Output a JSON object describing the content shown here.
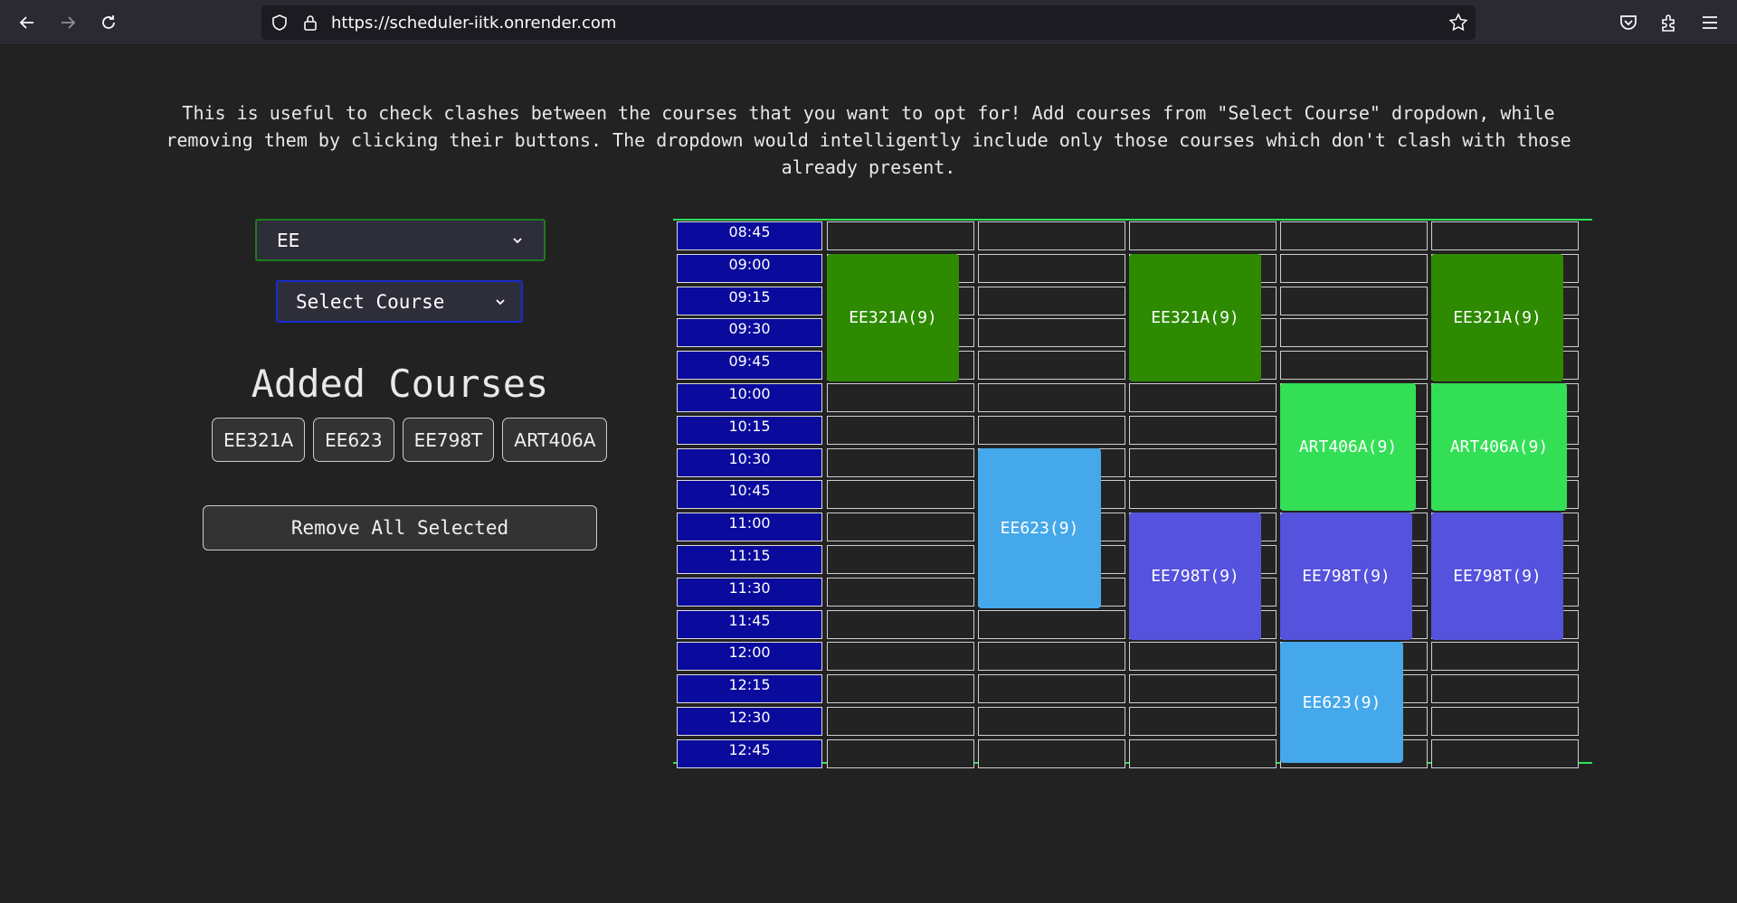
{
  "browser": {
    "url": "https://scheduler-iitk.onrender.com"
  },
  "intro_text": "This is useful to check clashes between the courses that you want to opt for! Add courses from \"Select Course\" dropdown, while removing them by clicking their buttons. The dropdown would intelligently include only those courses which don't clash with those already present.",
  "branch_select": {
    "value": "EE"
  },
  "course_select": {
    "value": "Select Course"
  },
  "added_courses": {
    "heading": "Added Courses",
    "items": [
      "EE321A",
      "EE623",
      "EE798T",
      "ART406A"
    ]
  },
  "remove_all_label": "Remove All Selected",
  "timetable": {
    "times": [
      "08:45",
      "09:00",
      "09:15",
      "09:30",
      "09:45",
      "10:00",
      "10:15",
      "10:30",
      "10:45",
      "11:00",
      "11:15",
      "11:30",
      "11:45",
      "12:00",
      "12:15",
      "12:30",
      "12:45"
    ],
    "day_columns": 5,
    "blocks": [
      {
        "label": "EE321A(9)",
        "day": 0,
        "start": "09:00",
        "slots": 4,
        "color": "#2e8a00"
      },
      {
        "label": "EE321A(9)",
        "day": 2,
        "start": "09:00",
        "slots": 4,
        "color": "#2e8a00"
      },
      {
        "label": "EE321A(9)",
        "day": 4,
        "start": "09:00",
        "slots": 4,
        "color": "#2e8a00"
      },
      {
        "label": "ART406A(9)",
        "day": 3,
        "start": "10:00",
        "slots": 4,
        "color": "#33df55"
      },
      {
        "label": "ART406A(9)",
        "day": 4,
        "start": "10:00",
        "slots": 4,
        "color": "#33df55"
      },
      {
        "label": "EE623(9)",
        "day": 1,
        "start": "10:30",
        "slots": 5,
        "color": "#45a8ea"
      },
      {
        "label": "EE798T(9)",
        "day": 2,
        "start": "11:00",
        "slots": 4,
        "color": "#5552dd"
      },
      {
        "label": "EE798T(9)",
        "day": 3,
        "start": "11:00",
        "slots": 4,
        "color": "#5552dd"
      },
      {
        "label": "EE798T(9)",
        "day": 4,
        "start": "11:00",
        "slots": 4,
        "color": "#5552dd"
      },
      {
        "label": "EE623(9)",
        "day": 3,
        "start": "12:00",
        "slots": 4,
        "color": "#45a8ea"
      }
    ]
  }
}
